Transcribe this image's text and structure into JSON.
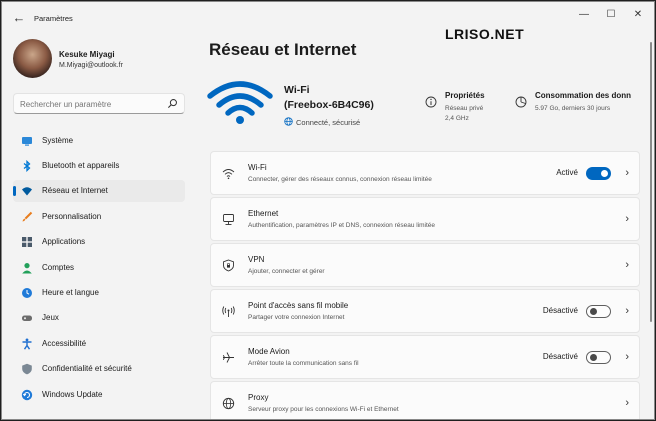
{
  "window": {
    "title": "Paramètres",
    "back_glyph": "←",
    "minimize_glyph": "—",
    "maximize_glyph": "☐",
    "close_glyph": "✕"
  },
  "profile": {
    "name": "Kesuke Miyagi",
    "email": "M.Miyagi@outlook.fr"
  },
  "search": {
    "placeholder": "Rechercher un paramètre",
    "icon": "search-icon"
  },
  "sidebar": {
    "items": [
      {
        "label": "Système",
        "icon": "monitor-icon",
        "color": "#2b88d8"
      },
      {
        "label": "Bluetooth et appareils",
        "icon": "bluetooth-icon",
        "color": "#0078d4"
      },
      {
        "label": "Réseau et Internet",
        "icon": "wifi-icon",
        "color": "#005a9e",
        "active": true
      },
      {
        "label": "Personnalisation",
        "icon": "brush-icon",
        "color": "#e87d1e"
      },
      {
        "label": "Applications",
        "icon": "apps-icon",
        "color": "#4a5a6a"
      },
      {
        "label": "Comptes",
        "icon": "person-icon",
        "color": "#22a05a"
      },
      {
        "label": "Heure et langue",
        "icon": "globe-clock-icon",
        "color": "#1f7ad8"
      },
      {
        "label": "Jeux",
        "icon": "gamepad-icon",
        "color": "#6c6c6c"
      },
      {
        "label": "Accessibilité",
        "icon": "accessibility-icon",
        "color": "#1f6fd0"
      },
      {
        "label": "Confidentialité et sécurité",
        "icon": "shield-icon",
        "color": "#7b8894"
      },
      {
        "label": "Windows Update",
        "icon": "update-icon",
        "color": "#1f7ad8"
      }
    ]
  },
  "header": {
    "title": "Réseau et Internet",
    "watermark": "LRISO.NET"
  },
  "connection": {
    "name": "Wi-Fi",
    "ssid": "(Freebox-6B4C96)",
    "status": "Connecté, sécurisé",
    "properties_title": "Propriétés",
    "properties_line1": "Réseau privé",
    "properties_line2": "2,4 GHz",
    "usage_title": "Consommation des donn",
    "usage_line": "5.97 Go, derniers 30 jours",
    "accent": "#0067c0"
  },
  "cards": [
    {
      "title": "Wi-Fi",
      "desc": "Connecter, gérer des réseaux connus, connexion réseau limitée",
      "icon": "wifi-icon",
      "toggle_label": "Activé",
      "toggle_on": true
    },
    {
      "title": "Ethernet",
      "desc": "Authentification, paramètres IP et DNS, connexion réseau limitée",
      "icon": "ethernet-icon"
    },
    {
      "title": "VPN",
      "desc": "Ajouter, connecter et gérer",
      "icon": "vpn-shield-icon"
    },
    {
      "title": "Point d'accès sans fil mobile",
      "desc": "Partager votre connexion Internet",
      "icon": "hotspot-icon",
      "toggle_label": "Désactivé",
      "toggle_on": false
    },
    {
      "title": "Mode Avion",
      "desc": "Arrêter toute la communication sans fil",
      "icon": "airplane-icon",
      "toggle_label": "Désactivé",
      "toggle_on": false
    },
    {
      "title": "Proxy",
      "desc": "Serveur proxy pour les connexions Wi-Fi et Ethernet",
      "icon": "globe-icon"
    }
  ],
  "chevron_glyph": "›"
}
